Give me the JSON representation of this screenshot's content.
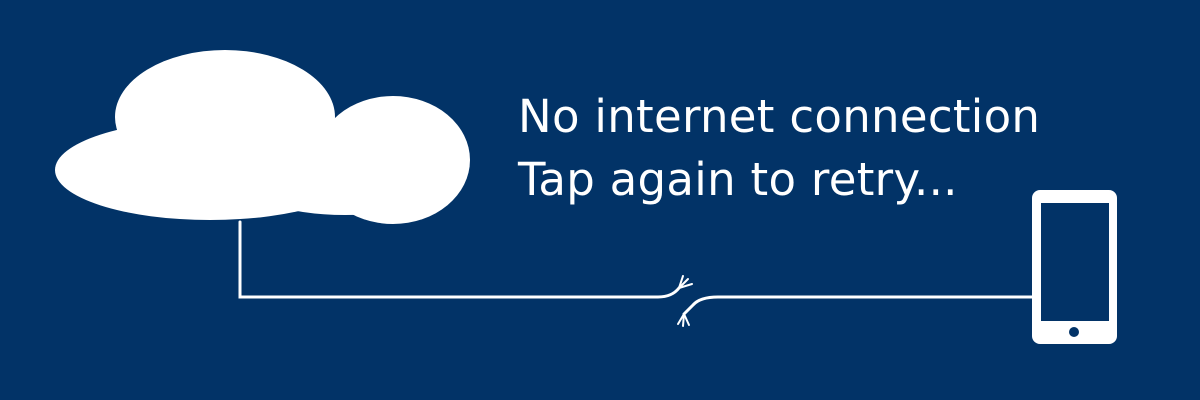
{
  "background_color": "#023367",
  "foreground_color": "#ffffff",
  "error": {
    "title": "No internet connection",
    "subtitle": "Tap again to retry..."
  },
  "illustration": {
    "source_icon": "cloud-icon",
    "cable": "broken-cable",
    "target_icon": "smartphone-icon"
  }
}
